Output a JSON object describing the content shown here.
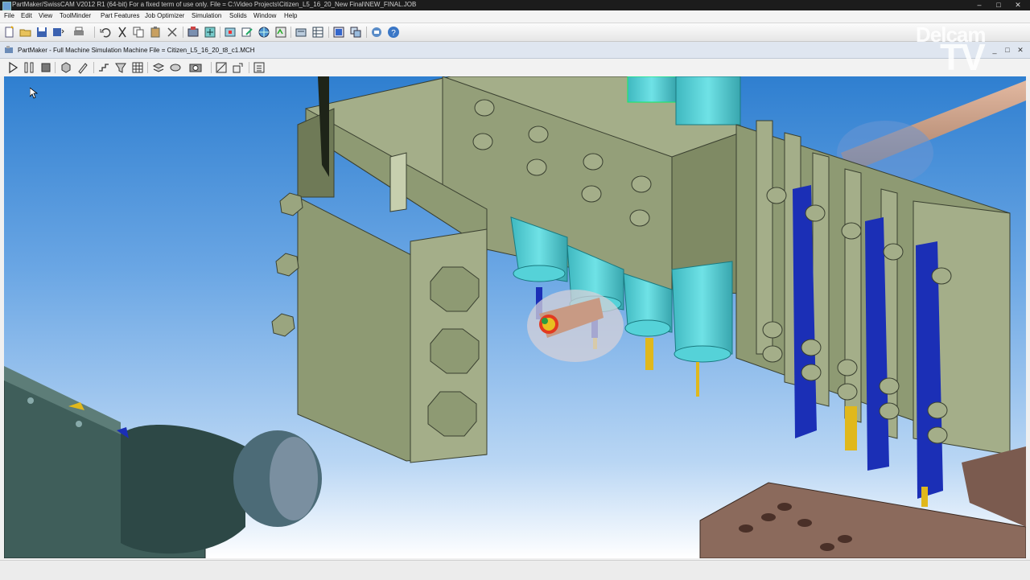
{
  "window": {
    "title": "PartMaker/SwissCAM V2012 R1 (64-bit)  For a fixed term of use only.   File = C:\\Video Projects\\Citizen_L5_16_20_New Final\\NEW_FINAL.JOB"
  },
  "menu": [
    "File",
    "Edit",
    "View",
    "ToolMinder",
    "Part Features",
    "Job Optimizer",
    "Simulation",
    "Solids",
    "Window",
    "Help"
  ],
  "toolbar": {
    "icons": [
      "new-icon",
      "open-icon",
      "save-icon",
      "save-as-icon",
      "print-icon",
      "undo-icon",
      "cut-icon",
      "copy-icon",
      "paste-icon",
      "delete-icon",
      "machine-icon",
      "job-icon",
      "tool-icon",
      "edit-icon",
      "globe-icon",
      "process-icon",
      "setup-icon",
      "table-icon",
      "window-icon",
      "layout-icon",
      "phone-icon",
      "help-icon"
    ]
  },
  "subwindow": {
    "title": "PartMaker - Full Machine Simulation   Machine File = Citizen_L5_16_20_t8_c1.MCH"
  },
  "simbar": {
    "icons": [
      "play-icon",
      "pause-icon",
      "stop-icon",
      "solid-icon",
      "pencil-icon",
      "step-icon",
      "filter-icon",
      "grid-icon",
      "layers-icon",
      "rotate-icon",
      "camera-icon",
      "measure-icon",
      "fit-icon",
      "settings-icon"
    ]
  },
  "watermark": {
    "line1": "Delcam",
    "line2": "TV"
  },
  "colors": {
    "body": "#8e9a73",
    "body_light": "#a4ae89",
    "body_dark": "#6f7a57",
    "holder": "#55d2d8",
    "tool_blue": "#1b2fb6",
    "tool_gold": "#e0b81c",
    "machine_dark": "#3f5e5a",
    "bar_stock": "#c9a08a"
  }
}
